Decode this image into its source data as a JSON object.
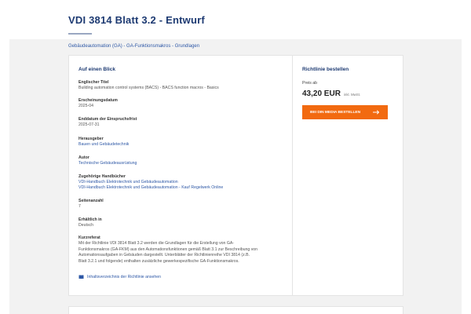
{
  "page": {
    "title": "VDI 3814 Blatt 3.2 - Entwurf",
    "breadcrumb": "Gebäudeautomation (GA) - GA-Funktionsmakros - Grundlagen"
  },
  "overview": {
    "heading": "Auf einen Blick",
    "fields": [
      {
        "label": "Englischer Titel",
        "values": [
          "Building automation control systems (BACS) - BACS function macros - Basics"
        ]
      },
      {
        "label": "Erscheinungsdatum",
        "values": [
          "2025-04"
        ]
      },
      {
        "label": "Enddatum der Einspruchsfrist",
        "values": [
          "2025-07-31"
        ]
      },
      {
        "label": "Herausgeber",
        "values": [
          "Bauen und Gebäudetechnik"
        ]
      },
      {
        "label": "Autor",
        "values": [
          "Technische Gebäudeausrüstung"
        ]
      },
      {
        "label": "Zugehörige Handbücher",
        "links": [
          "VDI-Handbuch Elektrotechnik und Gebäudeautomation",
          "VDI-Handbuch Elektrotechnik und Gebäudeautomation - Kauf Regelwerk Online"
        ]
      },
      {
        "label": "Seitenanzahl",
        "values": [
          "7"
        ]
      },
      {
        "label": "Erhältlich in",
        "values": [
          "Deutsch"
        ]
      }
    ],
    "abstract": {
      "label": "Kurzreferat",
      "lines": [
        "Mit der Richtlinie VDI 3814 Blatt 3.2 werden die Grundlagen für die Erstellung von GA-",
        "Funktionsmakros (GA-FKM) aus den Automationsfunktionen gemäß Blatt 3.1 zur Beschreibung von",
        "Automationsaufgaben in Gebäuden dargestellt. Unterblätter der Richtlinienreihe VDI 3814 (z.B.",
        "Blatt 3.2.1 und folgende) enthalten zusätzliche gewerkespezifische GA-Funktionsmakros."
      ]
    },
    "toc_link": "Inhaltsverzeichnis der Richtlinie ansehen"
  },
  "order": {
    "heading": "Richtlinie bestellen",
    "price_label": "Preis ab",
    "price": "43,20 EUR",
    "vat": "inkl. MwSt.",
    "button": "BEI DIN MEDIA BESTELLEN"
  },
  "colors": {
    "title_blue": "#1d3a72",
    "link_blue": "#2e58a6",
    "button_orange": "#f26a10",
    "background_gray": "#f2f2f2"
  }
}
